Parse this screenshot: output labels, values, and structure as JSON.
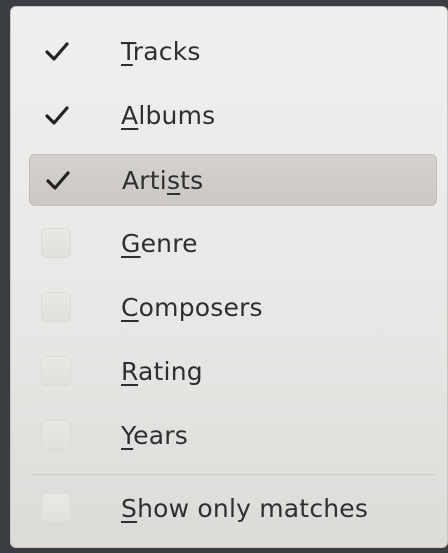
{
  "menu": {
    "items": [
      {
        "before": "",
        "mnemonic": "T",
        "after": "racks",
        "checked": true
      },
      {
        "before": "",
        "mnemonic": "A",
        "after": "lbums",
        "checked": true
      },
      {
        "before": "Arti",
        "mnemonic": "s",
        "after": "ts",
        "checked": true
      },
      {
        "before": "",
        "mnemonic": "G",
        "after": "enre",
        "checked": false
      },
      {
        "before": "",
        "mnemonic": "C",
        "after": "omposers",
        "checked": false
      },
      {
        "before": "",
        "mnemonic": "R",
        "after": "ating",
        "checked": false
      },
      {
        "before": "",
        "mnemonic": "Y",
        "after": "ears",
        "checked": false
      }
    ],
    "extra": {
      "before": "",
      "mnemonic": "S",
      "after": "how only matches",
      "checked": false
    }
  },
  "colors": {
    "highlight": "#cbc8c4",
    "text": "#2e2f30",
    "check": "#222222"
  }
}
